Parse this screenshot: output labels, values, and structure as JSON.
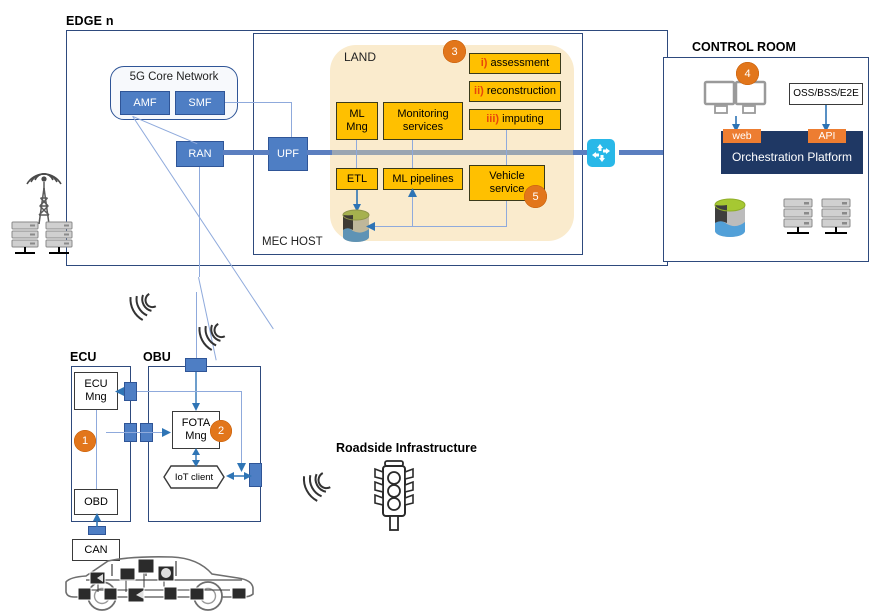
{
  "regions": {
    "edge": {
      "label": "EDGE n"
    },
    "mec": {
      "label": "MEC HOST"
    },
    "land": {
      "label": "LAND"
    },
    "control_room": {
      "label": "CONTROL ROOM"
    }
  },
  "core_network": {
    "title": "5G Core Network",
    "functions": [
      {
        "label": "AMF"
      },
      {
        "label": "SMF"
      }
    ]
  },
  "network_nodes": [
    {
      "label": "RAN"
    },
    {
      "label": "UPF"
    }
  ],
  "land_services": {
    "steps": [
      {
        "numeral": "i)",
        "label": " assessment"
      },
      {
        "numeral": "ii)",
        "label": " reconstruction"
      },
      {
        "numeral": "iii)",
        "label": " imputing"
      }
    ],
    "components": [
      {
        "label": "ML\nMng"
      },
      {
        "label": "Monitoring\nservices"
      },
      {
        "label": "ETL"
      },
      {
        "label": "ML pipelines"
      },
      {
        "label": "Vehicle\nservice"
      }
    ]
  },
  "control_room": {
    "oss_box": "OSS/BSS/E2E",
    "orchestration": "Orchestration Platform",
    "tags": [
      {
        "label": "web"
      },
      {
        "label": "API"
      }
    ]
  },
  "vehicle": {
    "ecu": {
      "label": "ECU"
    },
    "obu": {
      "label": "OBU"
    },
    "boxes": [
      {
        "label": "ECU\nMng"
      },
      {
        "label": "OBD"
      },
      {
        "label": "CAN"
      },
      {
        "label": "FOTA\nMng"
      }
    ],
    "iot_client": "IoT client"
  },
  "roadside": {
    "label": "Roadside Infrastructure"
  },
  "badges": [
    {
      "number": "1"
    },
    {
      "number": "2"
    },
    {
      "number": "3"
    },
    {
      "number": "4"
    },
    {
      "number": "5"
    }
  ],
  "colors": {
    "orange_box": "#FFC000",
    "blue_box": "#4E7EC4",
    "land_bg": "#FAEBCD",
    "orchestration_bg": "#1F3864",
    "tag_orange": "#ED7D31",
    "badge_orange": "#E2761B",
    "switch_cyan": "#29B8E8",
    "link_blue": "#5B7FC0",
    "frame_blue": "#2E4A7D"
  }
}
